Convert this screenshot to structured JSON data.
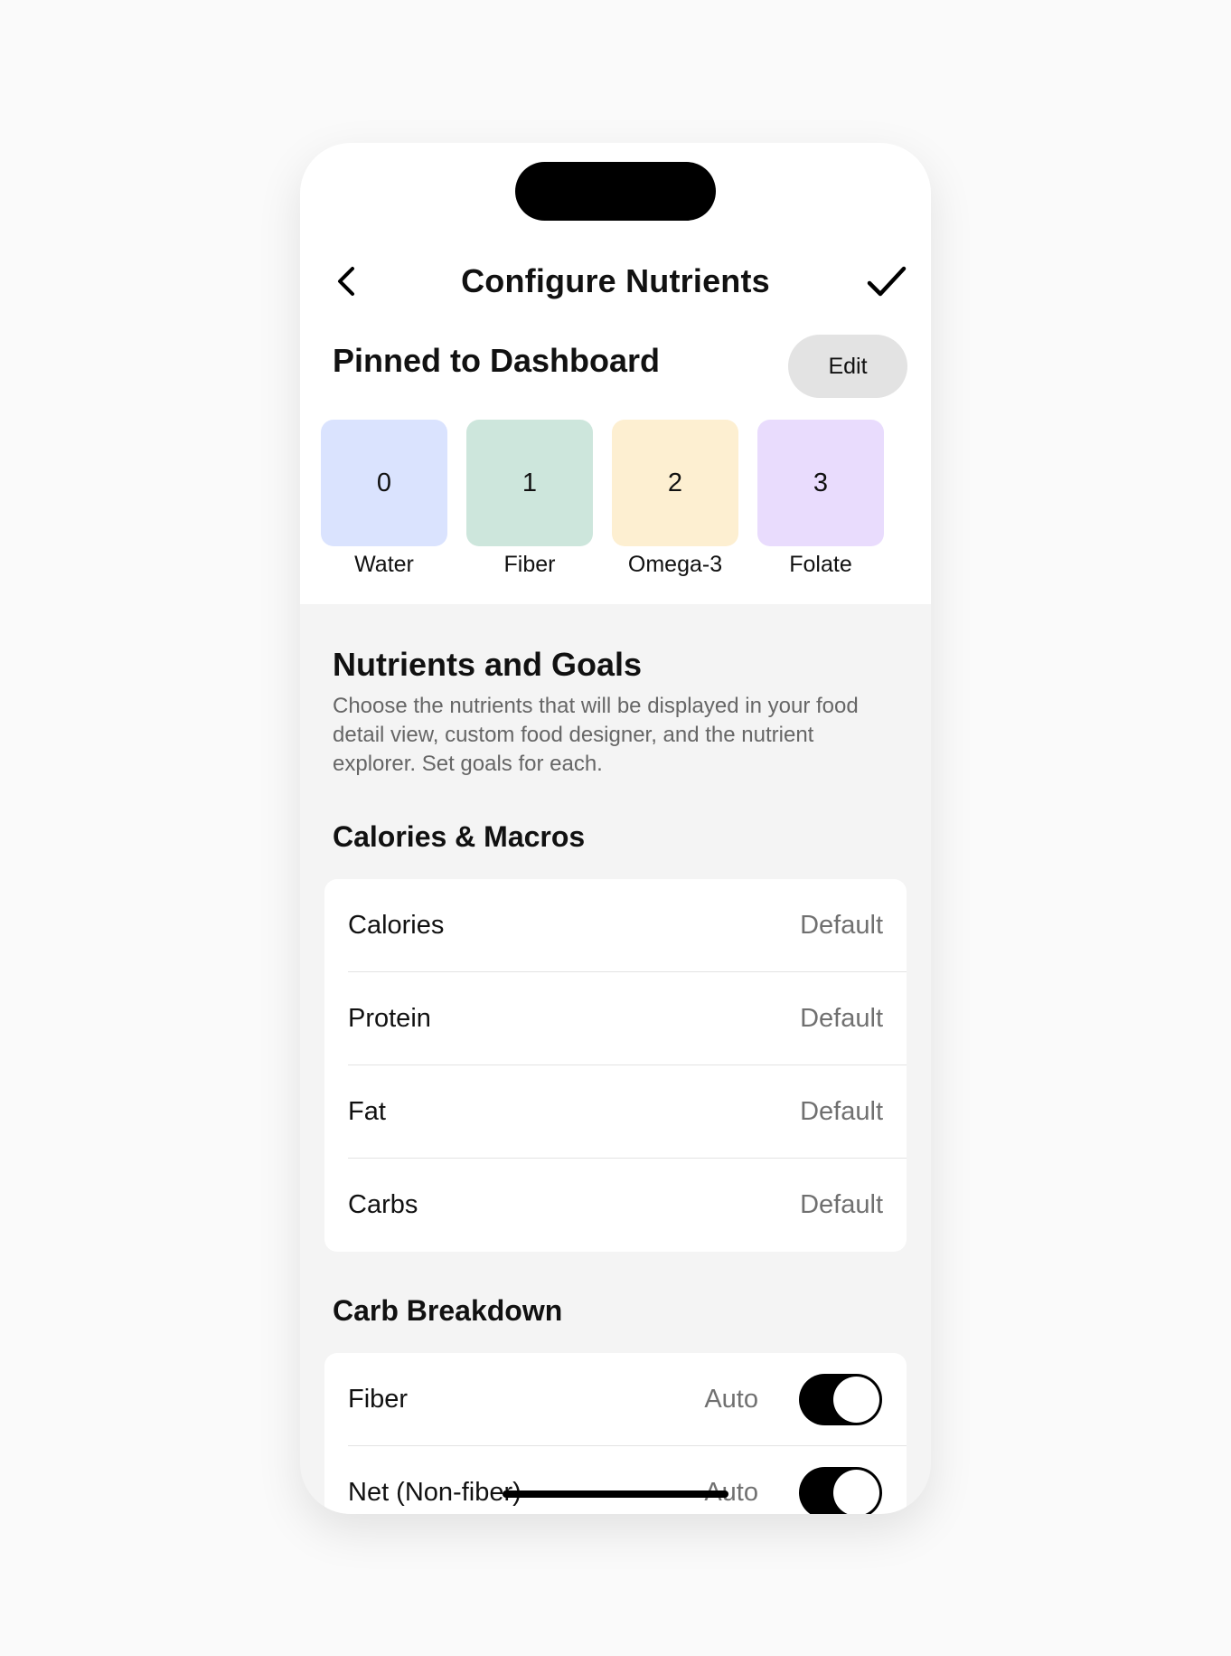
{
  "header": {
    "title": "Configure Nutrients"
  },
  "pinned": {
    "title": "Pinned to Dashboard",
    "edit_label": "Edit",
    "tiles": [
      {
        "number": "0",
        "label": "Water",
        "color": "#dae3fe"
      },
      {
        "number": "1",
        "label": "Fiber",
        "color": "#cde6dc"
      },
      {
        "number": "2",
        "label": "Omega-3",
        "color": "#fdefd1"
      },
      {
        "number": "3",
        "label": "Folate",
        "color": "#e9dcfd"
      }
    ]
  },
  "nutrients": {
    "title": "Nutrients and Goals",
    "description": "Choose the nutrients that will be displayed in your food detail view, custom food designer, and the nutrient explorer. Set goals for each."
  },
  "macros": {
    "title": "Calories & Macros",
    "rows": [
      {
        "label": "Calories",
        "value": "Default"
      },
      {
        "label": "Protein",
        "value": "Default"
      },
      {
        "label": "Fat",
        "value": "Default"
      },
      {
        "label": "Carbs",
        "value": "Default"
      }
    ]
  },
  "carbs": {
    "title": "Carb Breakdown",
    "rows": [
      {
        "label": "Fiber",
        "value": "Auto",
        "enabled": true
      },
      {
        "label": "Net (Non-fiber)",
        "value": "Auto",
        "enabled": true
      }
    ]
  },
  "icons": {
    "back": "chevron-left-icon",
    "confirm": "checkmark-icon"
  }
}
